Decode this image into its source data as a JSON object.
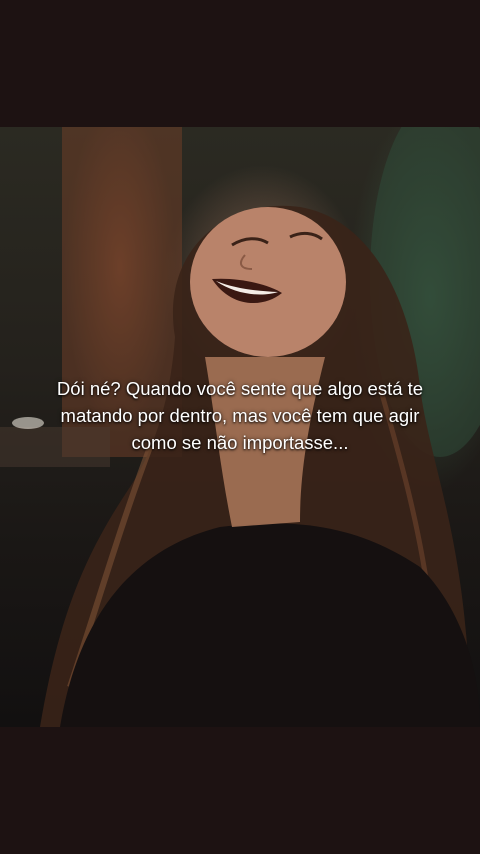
{
  "video": {
    "caption": "Dói né? Quando você sente que algo está te matando por dentro, mas você tem que agir como se não importasse..."
  },
  "colors": {
    "letterbox": "#1d1212",
    "caption_text": "#ffffff"
  }
}
